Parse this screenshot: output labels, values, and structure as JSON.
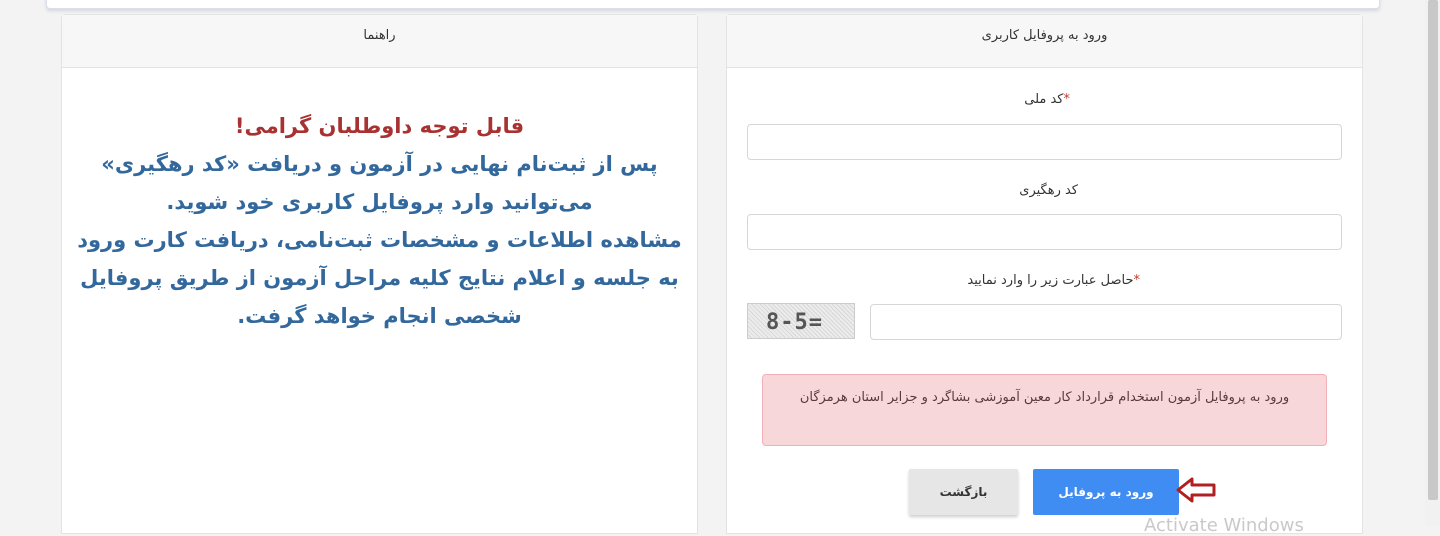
{
  "guide_panel": {
    "title": "راهنما",
    "notice_headline": "قابل توجه داوطلبان گرامی!",
    "notice_lines": [
      "پس از ثبت‌نام نهایی در آزمون و دریافت «کد رهگیری»",
      "می‌توانید وارد پروفایل کاربری خود شوید.",
      "مشاهده اطلاعات و مشخصات ثبت‌نامی، دریافت کارت ورود",
      "به جلسه و اعلام نتایج کلیه مراحل آزمون از طریق پروفایل",
      "شخصی انجام خواهد گرفت."
    ]
  },
  "login_panel": {
    "title": "ورود به پروفایل کاربری",
    "national_code": {
      "label": "کد ملی",
      "required_mark": "*",
      "value": ""
    },
    "tracking_code": {
      "label": "کد رهگیری",
      "value": ""
    },
    "captcha": {
      "label": "حاصل عبارت زیر را وارد نمایید",
      "required_mark": "*",
      "image_text": "8-5=",
      "value": ""
    },
    "alert_text": "ورود به پروفایل آزمون استخدام قرارداد کار معین آموزشی بشاگرد و جزایر استان هرمزگان",
    "login_button": "ورود به پروفایل",
    "back_button": "بازگشت"
  },
  "watermark": "Activate Windows",
  "colors": {
    "headline": "#a83232",
    "notice_text": "#33689c",
    "primary_button": "#3f8df2",
    "alert_bg": "#f8d7da",
    "arrow": "#b02020"
  }
}
